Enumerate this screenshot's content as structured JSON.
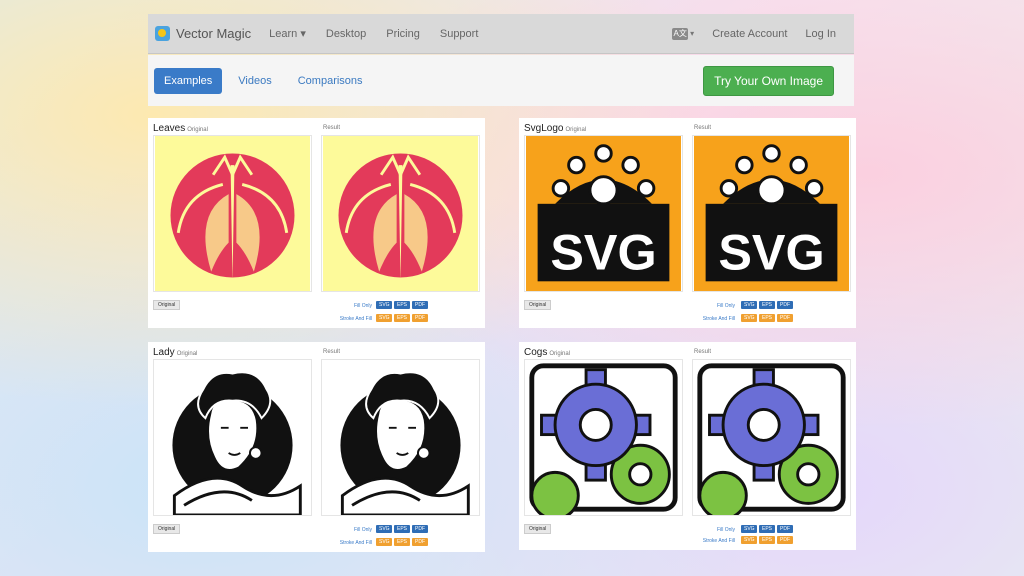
{
  "nav": {
    "brand": "Vector Magic",
    "learn": "Learn ▾",
    "desktop": "Desktop",
    "pricing": "Pricing",
    "support": "Support",
    "lang_icon": "A文",
    "lang_caret": "▾",
    "create_account": "Create Account",
    "login": "Log In"
  },
  "tabs": {
    "examples": "Examples",
    "videos": "Videos",
    "comparisons": "Comparisons",
    "try_button": "Try Your Own Image"
  },
  "cards": [
    {
      "title": "Leaves",
      "original": "Original",
      "result": "Result",
      "orig_btn": "Original",
      "fill_only": "Fill Only",
      "stroke_and_fill": "Stroke And Fill",
      "svg": "SVG",
      "eps": "EPS",
      "pdf": "PDF"
    },
    {
      "title": "SvgLogo",
      "original": "Original",
      "result": "Result",
      "orig_btn": "Original",
      "fill_only": "Fill Only",
      "stroke_and_fill": "Stroke And Fill",
      "svg": "SVG",
      "eps": "EPS",
      "pdf": "PDF",
      "logo_text": "SVG"
    },
    {
      "title": "Lady",
      "original": "Original",
      "result": "Result",
      "orig_btn": "Original",
      "fill_only": "Fill Only",
      "stroke_and_fill": "Stroke And Fill",
      "svg": "SVG",
      "eps": "EPS",
      "pdf": "PDF"
    },
    {
      "title": "Cogs",
      "original": "Original",
      "result": "Result",
      "orig_btn": "Original",
      "fill_only": "Fill Only",
      "stroke_and_fill": "Stroke And Fill",
      "svg": "SVG",
      "eps": "EPS",
      "pdf": "PDF"
    }
  ],
  "colors": {
    "accent_blue": "#3a7bc8",
    "button_green": "#4caf50",
    "format_orange": "#f0a030",
    "leaf_red": "#e33a5a",
    "leaf_bg": "#fdfa9a",
    "svg_orange": "#f7a21b",
    "cog_blue": "#6a6ed6",
    "cog_green": "#7cc242"
  }
}
